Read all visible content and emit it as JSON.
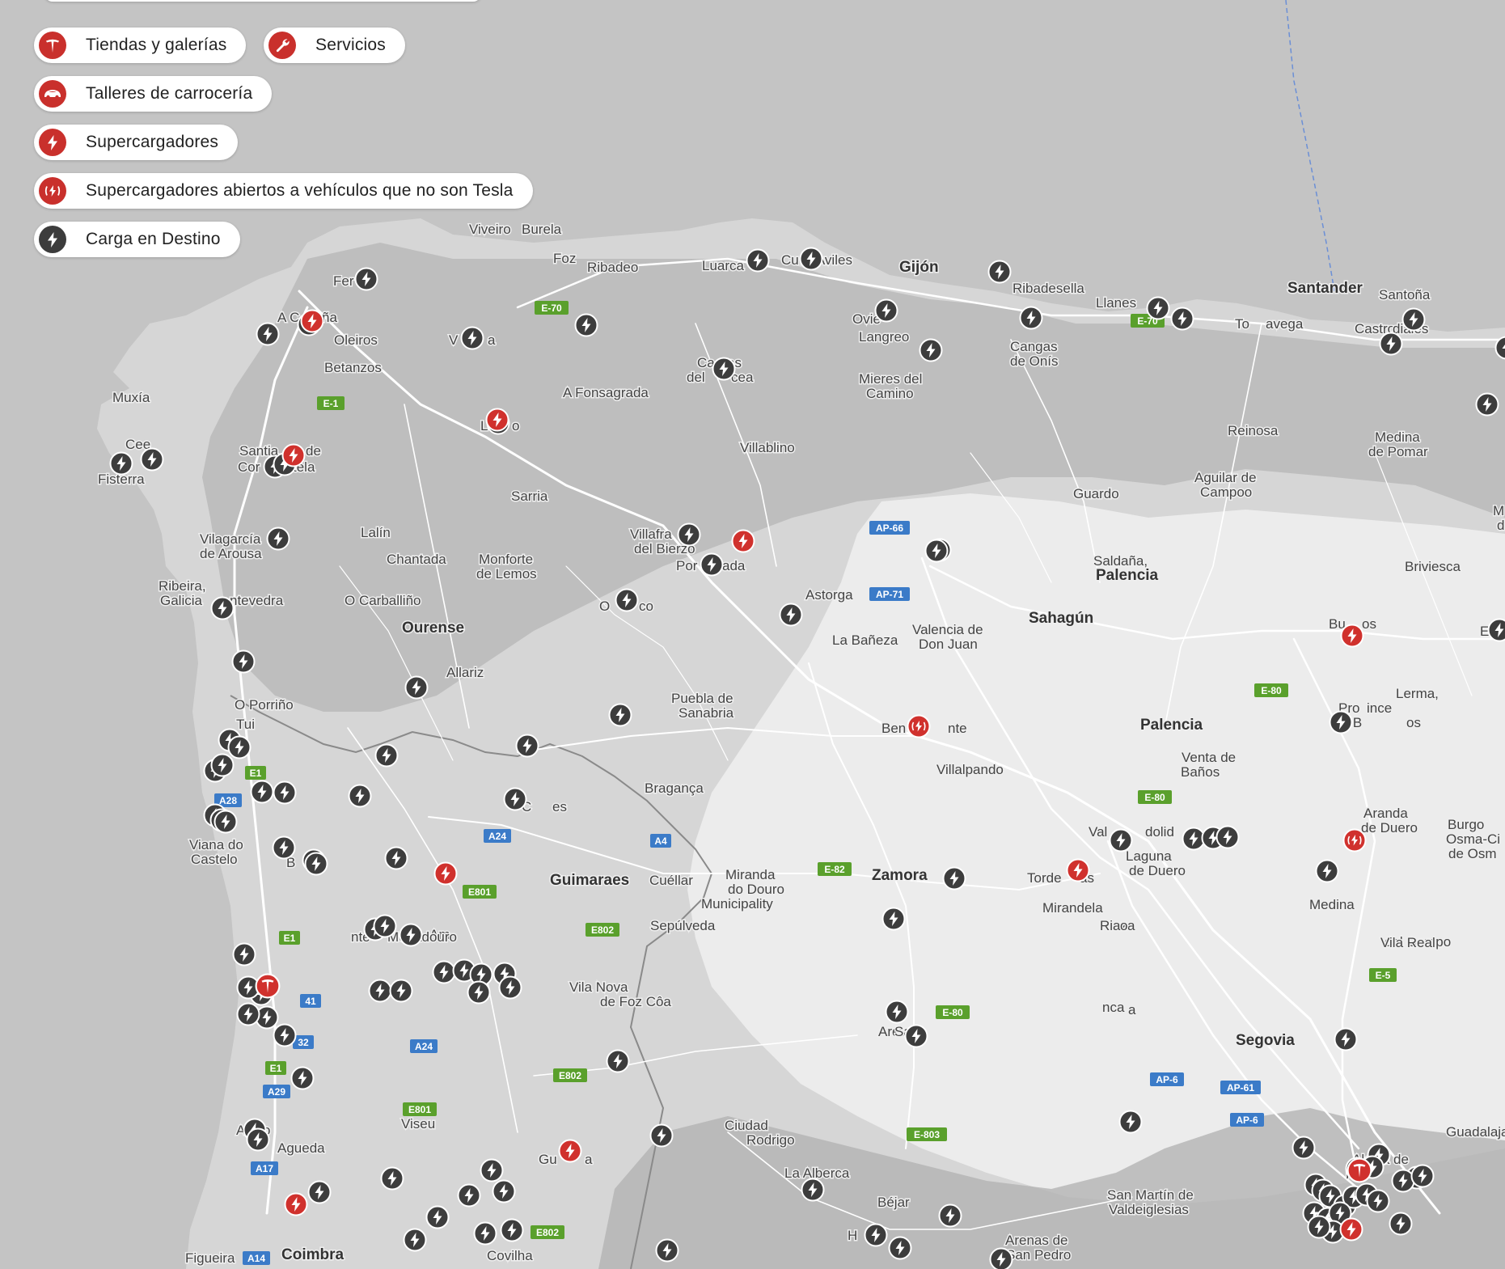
{
  "filters": [
    {
      "label": "Tiendas y galerías",
      "icon": "tesla-logo-icon",
      "color": "#c9302c"
    },
    {
      "label": "Servicios",
      "icon": "wrench-icon",
      "color": "#c9302c"
    },
    {
      "label": "Talleres de carrocería",
      "icon": "car-icon",
      "color": "#c9302c"
    },
    {
      "label": "Supercargadores",
      "icon": "bolt-icon",
      "color": "#c9302c"
    },
    {
      "label": "Supercargadores abiertos a vehículos que no son Tesla",
      "icon": "bolt-signal-icon",
      "color": "#c9302c"
    },
    {
      "label": "Carga en Destino",
      "icon": "bolt-icon",
      "color": "#3c3c3c"
    }
  ],
  "places": [
    {
      "name": "Viveiro"
    },
    {
      "name": "Burela"
    },
    {
      "name": "Foz"
    },
    {
      "name": "Ribadeo"
    },
    {
      "name": "Luarca"
    },
    {
      "name": "Cu"
    },
    {
      "name": "ro Aviles"
    },
    {
      "name": "Gijón"
    },
    {
      "name": "Ribadesella"
    },
    {
      "name": "Llanes"
    },
    {
      "name": "Santander"
    },
    {
      "name": "Santoña"
    },
    {
      "name": "To"
    },
    {
      "name": "avega"
    },
    {
      "name": "Castro"
    },
    {
      "name": "diales"
    },
    {
      "name": "Fer"
    },
    {
      "name": "A C"
    },
    {
      "name": "ña"
    },
    {
      "name": "Oleiros"
    },
    {
      "name": "Betanzos"
    },
    {
      "name": "V"
    },
    {
      "name": "a"
    },
    {
      "name": "Ovie"
    },
    {
      "name": "Langreo"
    },
    {
      "name": "Ca"
    },
    {
      "name": "as"
    },
    {
      "name": "del"
    },
    {
      "name": "cea"
    },
    {
      "name": "Mieres del"
    },
    {
      "name": "Camino"
    },
    {
      "name": "Cangas"
    },
    {
      "name": "de Onís"
    },
    {
      "name": "Muxía"
    },
    {
      "name": "L"
    },
    {
      "name": "o"
    },
    {
      "name": "A Fonsagrada"
    },
    {
      "name": "Reinosa"
    },
    {
      "name": "Medina"
    },
    {
      "name": "de Pomar"
    },
    {
      "name": "Cee"
    },
    {
      "name": "Fisterra"
    },
    {
      "name": "Santia"
    },
    {
      "name": "de"
    },
    {
      "name": "Cor"
    },
    {
      "name": "tela"
    },
    {
      "name": "Villablino"
    },
    {
      "name": "Guardo"
    },
    {
      "name": "Aguilar de"
    },
    {
      "name": "Campoo"
    },
    {
      "name": "Sarria"
    },
    {
      "name": "Villafra"
    },
    {
      "name": "del Bierzo"
    },
    {
      "name": "Por"
    },
    {
      "name": "ada"
    },
    {
      "name": "Lalín"
    },
    {
      "name": "Vilagarcía"
    },
    {
      "name": "de Arousa"
    },
    {
      "name": "Chantada"
    },
    {
      "name": "Monforte"
    },
    {
      "name": "de Lemos"
    },
    {
      "name": "Saldaña,"
    },
    {
      "name": "Palencia"
    },
    {
      "name": "Briviesca"
    },
    {
      "name": "Ribeira,"
    },
    {
      "name": "Galicia"
    },
    {
      "name": "ntevedra"
    },
    {
      "name": "O Carballiño"
    },
    {
      "name": "O"
    },
    {
      "name": "co"
    },
    {
      "name": "Astorga"
    },
    {
      "name": "Ourense"
    },
    {
      "name": "La Bañeza"
    },
    {
      "name": "Valencia de"
    },
    {
      "name": "Don Juan"
    },
    {
      "name": "Sahagún"
    },
    {
      "name": "Bu"
    },
    {
      "name": "os"
    },
    {
      "name": "Allariz"
    },
    {
      "name": "O Porriño"
    },
    {
      "name": "Tui"
    },
    {
      "name": "Puebla de"
    },
    {
      "name": "Sanabria"
    },
    {
      "name": "Ben"
    },
    {
      "name": "nte"
    },
    {
      "name": "Lerma,"
    },
    {
      "name": "Pro"
    },
    {
      "name": "ince"
    },
    {
      "name": "of B"
    },
    {
      "name": "os"
    },
    {
      "name": "Palencia"
    },
    {
      "name": "Venta de"
    },
    {
      "name": "Baños"
    },
    {
      "name": "Villalpando"
    },
    {
      "name": "Bragança"
    },
    {
      "name": "C"
    },
    {
      "name": "es"
    },
    {
      "name": "Aranda"
    },
    {
      "name": "de Duero"
    },
    {
      "name": "Burgo"
    },
    {
      "name": "Osma-Ci"
    },
    {
      "name": "de Osm"
    },
    {
      "name": "Val"
    },
    {
      "name": "dolid"
    },
    {
      "name": "Laguna"
    },
    {
      "name": "de Duero"
    },
    {
      "name": "Viana do"
    },
    {
      "name": "Castelo"
    },
    {
      "name": "B"
    },
    {
      "name": "Miranda"
    },
    {
      "name": "do Douro"
    },
    {
      "name": "Municipality"
    },
    {
      "name": "Zamora"
    },
    {
      "name": "Torde"
    },
    {
      "name": "as"
    },
    {
      "name": "Mirandela"
    },
    {
      "name": "Guimaraes"
    },
    {
      "name": "Cuéllar"
    },
    {
      "name": "Medina"
    },
    {
      "name": "del Campo"
    },
    {
      "name": "Vila Real"
    },
    {
      "name": "Am"
    },
    {
      "name": "nte"
    },
    {
      "name": "Mogadouro"
    },
    {
      "name": "Sepúlveda"
    },
    {
      "name": "Riaza"
    },
    {
      "name": "o"
    },
    {
      "name": "Vila Nova"
    },
    {
      "name": "de Foz Côa"
    },
    {
      "name": "Arévalo"
    },
    {
      "name": "Sal"
    },
    {
      "name": "nca"
    },
    {
      "name": "Segovia"
    },
    {
      "name": "Viseu"
    },
    {
      "name": "Agueda"
    },
    {
      "name": "Ciudad"
    },
    {
      "name": "Rodrigo"
    },
    {
      "name": "Gu"
    },
    {
      "name": "a"
    },
    {
      "name": "a"
    },
    {
      "name": "Guadalajara"
    },
    {
      "name": "Alcalá de"
    },
    {
      "name": "H"
    },
    {
      "name": "es"
    },
    {
      "name": "La Alberca"
    },
    {
      "name": "San Martín de"
    },
    {
      "name": "Valdeiglesias"
    },
    {
      "name": "Béjar"
    },
    {
      "name": "H"
    },
    {
      "name": "s"
    },
    {
      "name": "Arenas de"
    },
    {
      "name": "San Pedro"
    },
    {
      "name": "Figueira"
    },
    {
      "name": "Coimbra"
    },
    {
      "name": "Covilha"
    },
    {
      "name": "A"
    },
    {
      "name": "o"
    },
    {
      "name": "Ez"
    },
    {
      "name": "M"
    },
    {
      "name": "de"
    }
  ],
  "shields": [
    {
      "text": "E-70",
      "color": "#5aa02c"
    },
    {
      "text": "E-70",
      "color": "#5aa02c"
    },
    {
      "text": "E-1",
      "color": "#5aa02c"
    },
    {
      "text": "AP-66",
      "color": "#3b7bc8"
    },
    {
      "text": "AP-71",
      "color": "#3b7bc8"
    },
    {
      "text": "E-80",
      "color": "#5aa02c"
    },
    {
      "text": "E-80",
      "color": "#5aa02c"
    },
    {
      "text": "E1",
      "color": "#5aa02c"
    },
    {
      "text": "A28",
      "color": "#3b7bc8"
    },
    {
      "text": "A24",
      "color": "#3b7bc8"
    },
    {
      "text": "A4",
      "color": "#3b7bc8"
    },
    {
      "text": "E-82",
      "color": "#5aa02c"
    },
    {
      "text": "E801",
      "color": "#5aa02c"
    },
    {
      "text": "E1",
      "color": "#5aa02c"
    },
    {
      "text": "E802",
      "color": "#5aa02c"
    },
    {
      "text": "41",
      "color": "#3b7bc8"
    },
    {
      "text": "32",
      "color": "#3b7bc8"
    },
    {
      "text": "A24",
      "color": "#3b7bc8"
    },
    {
      "text": "E-80",
      "color": "#5aa02c"
    },
    {
      "text": "E-5",
      "color": "#5aa02c"
    },
    {
      "text": "E1",
      "color": "#5aa02c"
    },
    {
      "text": "A29",
      "color": "#3b7bc8"
    },
    {
      "text": "E802",
      "color": "#5aa02c"
    },
    {
      "text": "E801",
      "color": "#5aa02c"
    },
    {
      "text": "AP-6",
      "color": "#3b7bc8"
    },
    {
      "text": "AP-61",
      "color": "#3b7bc8"
    },
    {
      "text": "AP-6",
      "color": "#3b7bc8"
    },
    {
      "text": "E-803",
      "color": "#5aa02c"
    },
    {
      "text": "A17",
      "color": "#3b7bc8"
    },
    {
      "text": "E802",
      "color": "#5aa02c"
    },
    {
      "text": "A14",
      "color": "#3b7bc8"
    }
  ],
  "map_colors": {
    "sea": "#c4c4c4",
    "land": "#d8d8d8",
    "relief": "#b5b5b5",
    "plain": "#ececec",
    "road": "#ffffff"
  }
}
